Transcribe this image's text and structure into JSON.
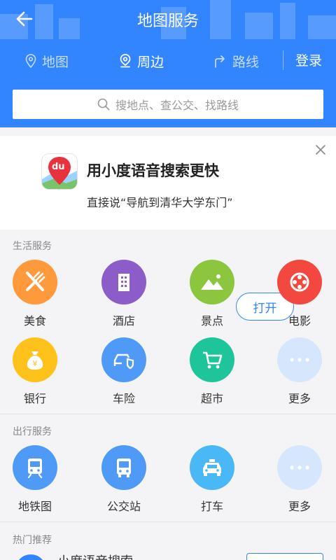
{
  "header": {
    "title": "地图服务",
    "tabs": [
      {
        "label": "地图",
        "icon": "location-pin-icon",
        "active": false
      },
      {
        "label": "周边",
        "icon": "nearby-pin-icon",
        "active": true
      },
      {
        "label": "路线",
        "icon": "route-arrow-icon",
        "active": false
      }
    ],
    "login_label": "登录"
  },
  "search": {
    "placeholder": "搜地点、查公交、找路线"
  },
  "promo": {
    "headline": "用小度语音搜索更快",
    "subtext": "直接说“导航到清华大学东门”",
    "open_label": "打开",
    "app_icon_text": "du"
  },
  "life_services": {
    "title": "生活服务",
    "items": [
      {
        "label": "美食",
        "icon": "fork-knife-icon",
        "color": "#ff9a3c"
      },
      {
        "label": "酒店",
        "icon": "building-icon",
        "color": "#8c5cc8"
      },
      {
        "label": "景点",
        "icon": "mountain-icon",
        "color": "#8cc63f"
      },
      {
        "label": "电影",
        "icon": "film-reel-icon",
        "color": "#f3483f"
      },
      {
        "label": "银行",
        "icon": "money-bag-icon",
        "color": "#ffc21a"
      },
      {
        "label": "车险",
        "icon": "car-shield-icon",
        "color": "#4f9af7"
      },
      {
        "label": "超市",
        "icon": "shopping-cart-icon",
        "color": "#1fc59a"
      },
      {
        "label": "更多",
        "icon": "more-dots-icon",
        "color": "#d6e6fd"
      }
    ]
  },
  "travel_services": {
    "title": "出行服务",
    "items": [
      {
        "label": "地铁图",
        "icon": "subway-icon",
        "color": "#4f9af7"
      },
      {
        "label": "公交站",
        "icon": "bus-icon",
        "color": "#4f9af7"
      },
      {
        "label": "打车",
        "icon": "taxi-icon",
        "color": "#4ab8f7"
      },
      {
        "label": "更多",
        "icon": "more-dots-icon",
        "color": "#d6e6fd"
      }
    ]
  },
  "hot": {
    "title": "热门推荐",
    "first_item_title": "小度语音搜索"
  }
}
